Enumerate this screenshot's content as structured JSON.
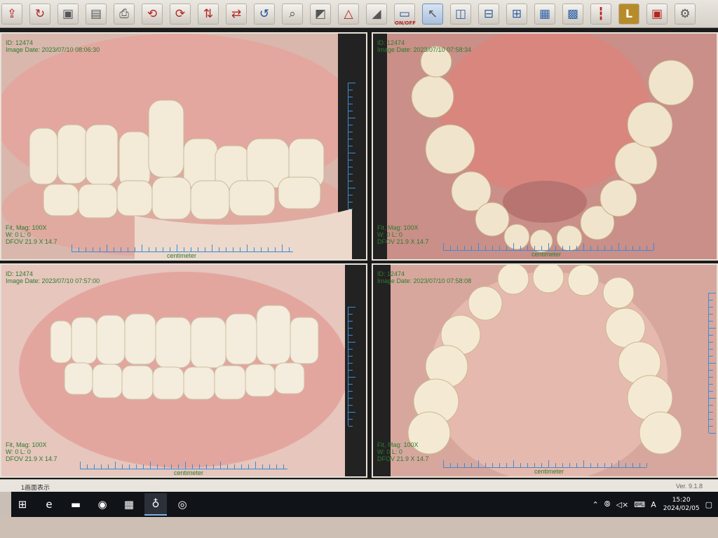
{
  "toolbar": {
    "buttons": [
      {
        "name": "open-icon",
        "glyph": "⇪",
        "tone": "red"
      },
      {
        "name": "import-icon",
        "glyph": "↻",
        "tone": "red"
      },
      {
        "name": "save-icon",
        "glyph": "▣",
        "tone": ""
      },
      {
        "name": "save-as-icon",
        "glyph": "▤",
        "tone": ""
      },
      {
        "name": "print-icon",
        "glyph": "⎙",
        "tone": ""
      },
      {
        "name": "rotate-left-icon",
        "glyph": "⟲",
        "tone": "red"
      },
      {
        "name": "rotate-right-icon",
        "glyph": "⟳",
        "tone": "red"
      },
      {
        "name": "flip-vertical-icon",
        "glyph": "⇅",
        "tone": "red"
      },
      {
        "name": "flip-horizontal-icon",
        "glyph": "⇄",
        "tone": "red"
      },
      {
        "name": "undo-icon",
        "glyph": "↺",
        "tone": "blue"
      },
      {
        "name": "zoom-icon",
        "glyph": "⌕",
        "tone": ""
      },
      {
        "name": "crop-icon",
        "glyph": "◩",
        "tone": ""
      },
      {
        "name": "measure-icon",
        "glyph": "△",
        "tone": "red"
      },
      {
        "name": "contrast-icon",
        "glyph": "◢",
        "tone": ""
      },
      {
        "name": "onoff-icon",
        "glyph": "▭",
        "tone": "blue",
        "label": "ON/OFF"
      },
      {
        "name": "pointer-icon",
        "glyph": "↖",
        "tone": "",
        "active": true
      },
      {
        "name": "layout-2col-icon",
        "glyph": "◫",
        "tone": "grid"
      },
      {
        "name": "layout-2row-icon",
        "glyph": "⊟",
        "tone": "grid"
      },
      {
        "name": "layout-4grid-icon",
        "glyph": "⊞",
        "tone": "grid"
      },
      {
        "name": "layout-6grid-icon",
        "glyph": "▦",
        "tone": "grid"
      },
      {
        "name": "layout-9grid-icon",
        "glyph": "▩",
        "tone": "grid"
      },
      {
        "name": "ruler-icon",
        "glyph": "┇",
        "tone": "red"
      },
      {
        "name": "lab-l-icon",
        "glyph": "L",
        "tone": "L"
      },
      {
        "name": "book-icon",
        "glyph": "▣",
        "tone": "red"
      },
      {
        "name": "settings-gear-icon",
        "glyph": "⚙",
        "tone": ""
      }
    ]
  },
  "panels": [
    {
      "id": "ID: 12474",
      "date": "Image Date: 2023/07/10 08:06:30",
      "mag": "Fit, Mag: 100X",
      "wl": "W: 0 L: 0",
      "dfov": "DFOV 21.9 X 14.7",
      "unit": "centimeter"
    },
    {
      "id": "ID: 12474",
      "date": "Image Date: 2023/07/10 07:58:34",
      "mag": "Fit, Mag: 100X",
      "wl": "W: 0 L: 0",
      "dfov": "DFOV 21.9 X 14.7",
      "unit": "centimeter"
    },
    {
      "id": "ID: 12474",
      "date": "Image Date: 2023/07/10 07:57:00",
      "mag": "Fit, Mag: 100X",
      "wl": "W: 0 L: 0",
      "dfov": "DFOV 21.9 X 14.7",
      "unit": "centimeter"
    },
    {
      "id": "ID: 12474",
      "date": "Image Date: 2023/07/10 07:58:08",
      "mag": "Fit, Mag: 100X",
      "wl": "W: 0 L: 0",
      "dfov": "DFOV 21.9 X 14.7",
      "unit": "centimeter"
    }
  ],
  "statusbar": {
    "left": "1画面表示",
    "version": "Ver. 9.1.8"
  },
  "taskbar": {
    "apps": [
      {
        "name": "windows-start-icon",
        "glyph": "⊞"
      },
      {
        "name": "edge-browser-icon",
        "glyph": "e"
      },
      {
        "name": "file-explorer-icon",
        "glyph": "▬"
      },
      {
        "name": "dental-app-icon",
        "glyph": "◉"
      },
      {
        "name": "photo-app-icon",
        "glyph": "▦"
      },
      {
        "name": "tooth-app-icon",
        "glyph": "♁"
      },
      {
        "name": "camera-app-icon",
        "glyph": "◎"
      }
    ],
    "tray": {
      "ime": "A",
      "time": "15:20",
      "date": "2024/02/05"
    }
  },
  "colors": {
    "overlay_text": "#2f7a2f",
    "ruler": "#3c8bd6",
    "gum": "#d8958f",
    "tooth": "#f3ead8"
  }
}
